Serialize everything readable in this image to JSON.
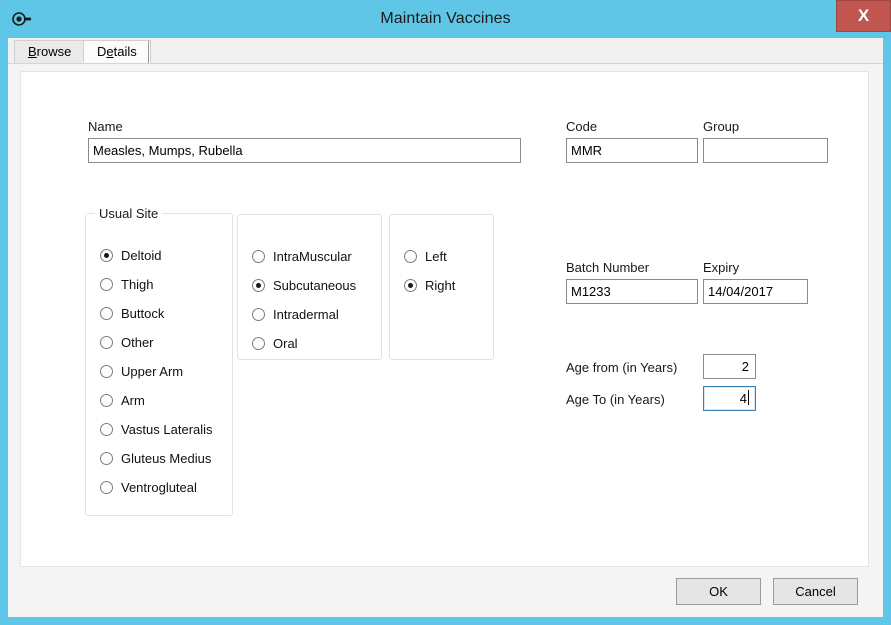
{
  "window": {
    "title": "Maintain Vaccines",
    "app_icon": "vaccine-syringe-icon",
    "close_label": "X",
    "titlebar_color": "#5fc6e8",
    "close_color": "#c0564f"
  },
  "tabs": [
    {
      "label": "Browse",
      "accel": "B",
      "active": false
    },
    {
      "label": "Details",
      "accel": "e",
      "active": true
    }
  ],
  "form": {
    "name": {
      "label": "Name",
      "value": "Measles, Mumps, Rubella",
      "placeholder": ""
    },
    "code": {
      "label": "Code",
      "value": "MMR",
      "placeholder": ""
    },
    "group": {
      "label": "Group",
      "value": "",
      "placeholder": ""
    },
    "batch_number": {
      "label": "Batch Number",
      "value": "M1233",
      "placeholder": ""
    },
    "expiry": {
      "label": "Expiry",
      "value": "14/04/2017",
      "placeholder": ""
    },
    "age_from": {
      "label": "Age from (in Years)",
      "value": "2",
      "placeholder": ""
    },
    "age_to": {
      "label": "Age To (in Years)",
      "value": "4",
      "placeholder": "",
      "focused": true
    }
  },
  "usual_site": {
    "title": "Usual Site",
    "selected": "Deltoid",
    "options": [
      "Deltoid",
      "Thigh",
      "Buttock",
      "Other",
      "Upper Arm",
      "Arm",
      "Vastus Lateralis",
      "Gluteus Medius",
      "Ventrogluteal"
    ]
  },
  "route": {
    "title": "",
    "selected": "Subcutaneous",
    "options": [
      "IntraMuscular",
      "Subcutaneous",
      "Intradermal",
      "Oral"
    ]
  },
  "side": {
    "title": "",
    "selected": "Right",
    "options": [
      "Left",
      "Right"
    ]
  },
  "footer": {
    "ok_label": "OK",
    "cancel_label": "Cancel"
  }
}
